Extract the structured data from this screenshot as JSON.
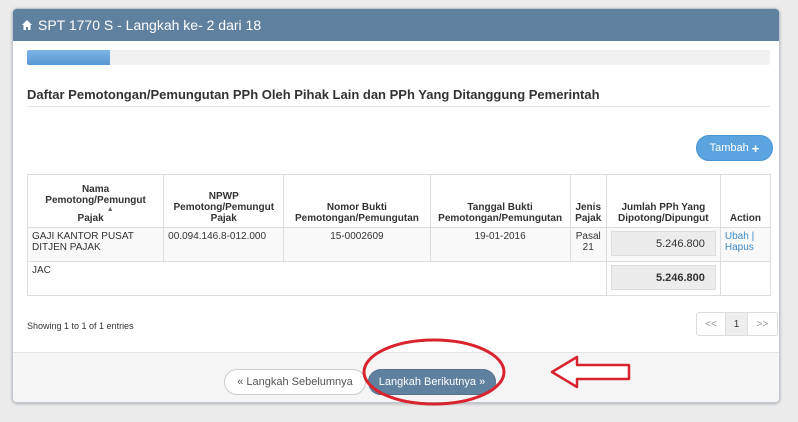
{
  "header": {
    "title": "SPT 1770 S - Langkah ke- 2 dari 18"
  },
  "progress": {
    "current_step": 2,
    "total_steps": 18
  },
  "section": {
    "title": "Daftar Pemotongan/Pemungutan PPh Oleh Pihak Lain dan PPh Yang Ditanggung Pemerintah"
  },
  "actions": {
    "tambah_label": "Tambah",
    "plus_glyph": "+"
  },
  "table": {
    "headers": {
      "nama": "Nama Pemotong/Pemungut Pajak",
      "npwp": "NPWP Pemotong/Pemungut Pajak",
      "nomor": "Nomor Bukti Pemotongan/Pemungutan",
      "tanggal": "Tanggal Bukti Pemotongan/Pemungutan",
      "jenis": "Jenis Pajak",
      "jumlah": "Jumlah PPh Yang Dipotong/Dipungut",
      "action": "Action"
    },
    "sort_glyph": "▲",
    "rows": [
      {
        "nama": "GAJI KANTOR PUSAT DITJEN PAJAK",
        "npwp": "00.094.146.8-012.000",
        "nomor": "15-0002609",
        "tanggal": "19-01-2016",
        "jenis": "Pasal 21",
        "jumlah": "5.246.800",
        "ubah": "Ubah",
        "separator": " | ",
        "hapus": "Hapus"
      }
    ],
    "total": {
      "label": "JAC",
      "value": "5.246.800"
    }
  },
  "info": {
    "showing": "Showing 1 to 1 of 1 entries"
  },
  "pagination": {
    "prev": "<<",
    "page": "1",
    "next": ">>"
  },
  "footer": {
    "prev_label": "« Langkah Sebelumnya",
    "next_label": "Langkah Berikutnya »"
  },
  "colors": {
    "header_bg": "#60809f",
    "accent_blue": "#5ba4e0",
    "annotation_red": "#d9232e"
  }
}
